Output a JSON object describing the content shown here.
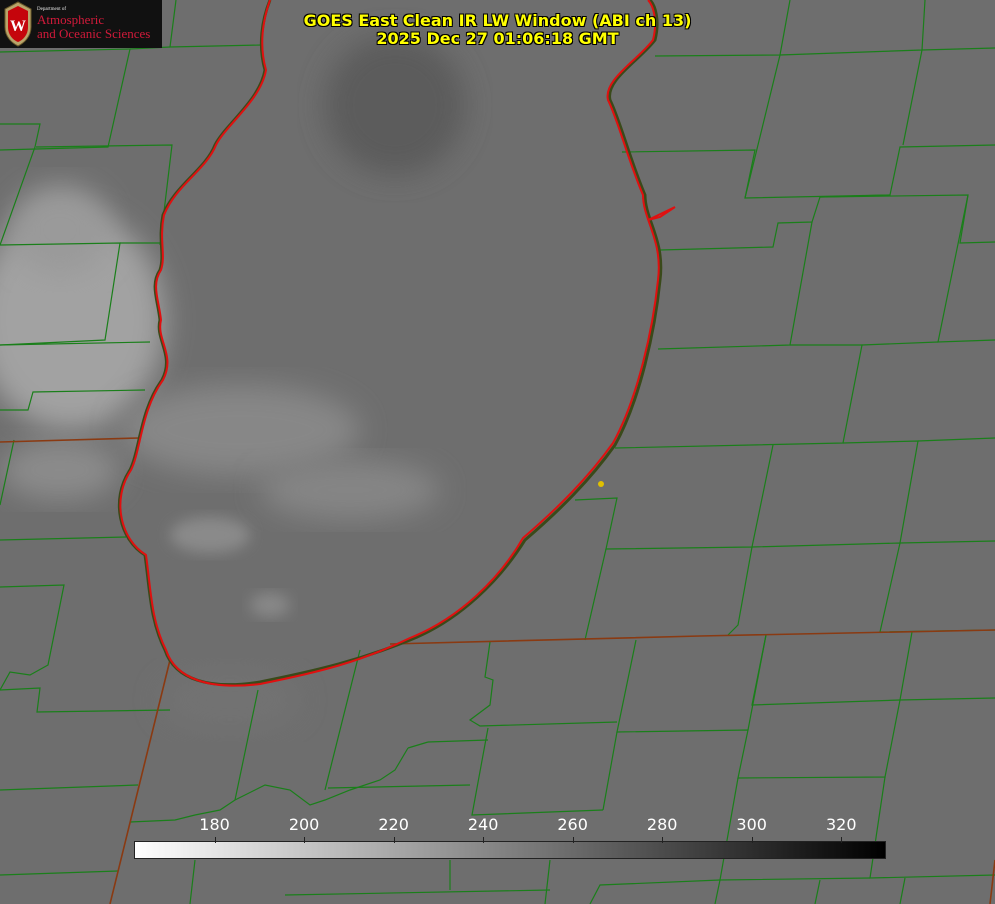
{
  "title": {
    "line1": "GOES East Clean IR LW Window (ABI ch 13)",
    "line2": "2025 Dec 27 01:06:18 GMT"
  },
  "logo": {
    "dept": "Department of",
    "line1": "Atmospheric",
    "line2": "and Oceanic Sciences",
    "seal_letter": "W"
  },
  "colorbar": {
    "min": 162,
    "max": 330,
    "ticks": [
      {
        "value": 180,
        "label": "180"
      },
      {
        "value": 200,
        "label": "200"
      },
      {
        "value": 220,
        "label": "220"
      },
      {
        "value": 240,
        "label": "240"
      },
      {
        "value": 260,
        "label": "260"
      },
      {
        "value": 280,
        "label": "280"
      },
      {
        "value": 300,
        "label": "300"
      },
      {
        "value": 320,
        "label": "320"
      }
    ],
    "gradient": [
      "#ffffff",
      "#000000"
    ]
  },
  "colors": {
    "title_text": "#ffff00",
    "county_lines": "#1a7f1a",
    "state_lines": "#8a3a12",
    "lake_outline": "#e01010",
    "marker": "#e0c000",
    "background_gray": "#6f6f6f"
  }
}
